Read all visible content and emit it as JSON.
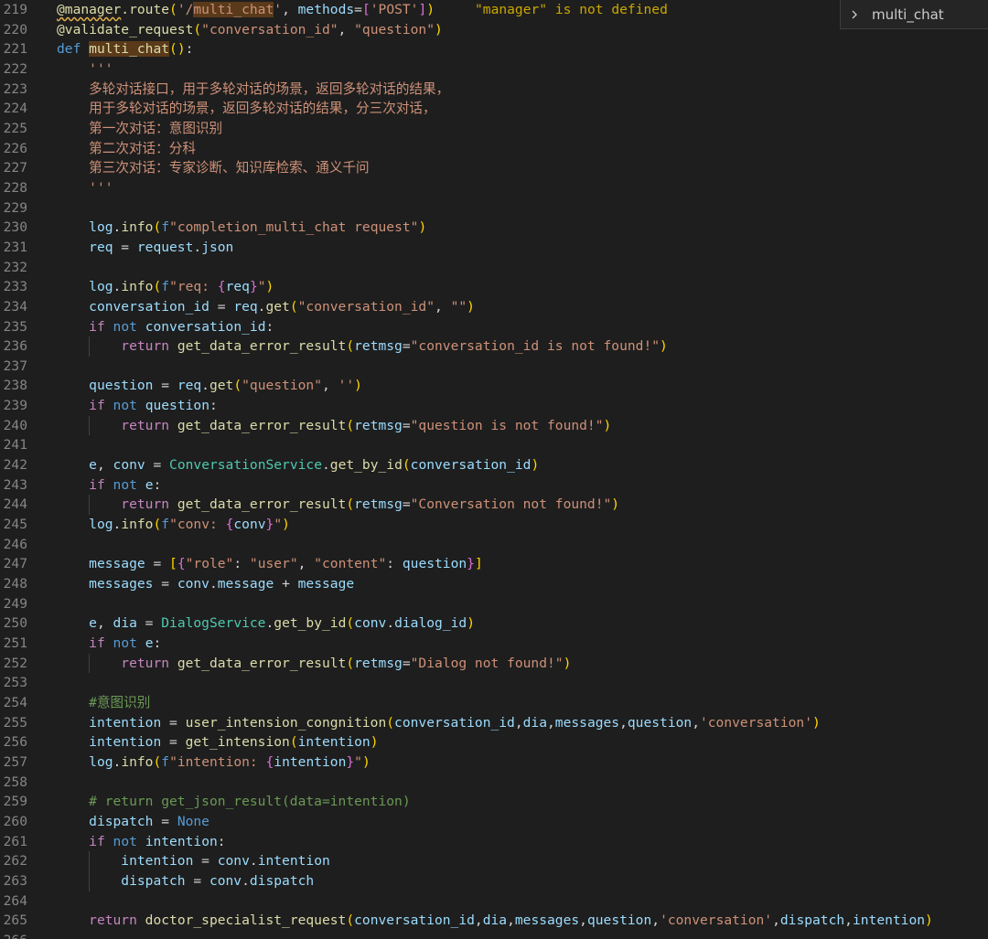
{
  "editor": {
    "language": "python",
    "theme": "dark",
    "colors": {
      "background": "#1e1e1e",
      "line_number": "#858585",
      "keyword": "#569cd6",
      "control_keyword": "#c586c0",
      "function": "#dcdcaa",
      "string": "#ce9178",
      "variable": "#9cdcfe",
      "class": "#4ec9b0",
      "comment": "#6a9955",
      "highlight": "#5a3a1a"
    },
    "diagnostic": "\"manager\" is not defined",
    "breadcrumb": {
      "icon": "chevron-right-icon",
      "label": "multi_chat"
    },
    "lines": [
      {
        "n": "219",
        "text": "@manager.route('/multi_chat', methods=['POST'])"
      },
      {
        "n": "220",
        "text": "@validate_request(\"conversation_id\", \"question\")"
      },
      {
        "n": "221",
        "text": "def multi_chat():"
      },
      {
        "n": "222",
        "text": "    '''"
      },
      {
        "n": "223",
        "text": "    多轮对话接口，用于多轮对话的场景，返回多轮对话的结果，"
      },
      {
        "n": "224",
        "text": "    用于多轮对话的场景，返回多轮对话的结果，分三次对话，"
      },
      {
        "n": "225",
        "text": "    第一次对话：意图识别"
      },
      {
        "n": "226",
        "text": "    第二次对话：分科"
      },
      {
        "n": "227",
        "text": "    第三次对话：专家诊断、知识库检索、通义千问"
      },
      {
        "n": "228",
        "text": "    '''"
      },
      {
        "n": "229",
        "text": ""
      },
      {
        "n": "230",
        "text": "    log.info(f\"completion_multi_chat request\")"
      },
      {
        "n": "231",
        "text": "    req = request.json"
      },
      {
        "n": "232",
        "text": ""
      },
      {
        "n": "233",
        "text": "    log.info(f\"req: {req}\")"
      },
      {
        "n": "234",
        "text": "    conversation_id = req.get(\"conversation_id\", \"\")"
      },
      {
        "n": "235",
        "text": "    if not conversation_id:"
      },
      {
        "n": "236",
        "text": "        return get_data_error_result(retmsg=\"conversation_id is not found!\")"
      },
      {
        "n": "237",
        "text": ""
      },
      {
        "n": "238",
        "text": "    question = req.get(\"question\", '')"
      },
      {
        "n": "239",
        "text": "    if not question:"
      },
      {
        "n": "240",
        "text": "        return get_data_error_result(retmsg=\"question is not found!\")"
      },
      {
        "n": "241",
        "text": ""
      },
      {
        "n": "242",
        "text": "    e, conv = ConversationService.get_by_id(conversation_id)"
      },
      {
        "n": "243",
        "text": "    if not e:"
      },
      {
        "n": "244",
        "text": "        return get_data_error_result(retmsg=\"Conversation not found!\")"
      },
      {
        "n": "245",
        "text": "    log.info(f\"conv: {conv}\")"
      },
      {
        "n": "246",
        "text": ""
      },
      {
        "n": "247",
        "text": "    message = [{\"role\": \"user\", \"content\": question}]"
      },
      {
        "n": "248",
        "text": "    messages = conv.message + message"
      },
      {
        "n": "249",
        "text": ""
      },
      {
        "n": "250",
        "text": "    e, dia = DialogService.get_by_id(conv.dialog_id)"
      },
      {
        "n": "251",
        "text": "    if not e:"
      },
      {
        "n": "252",
        "text": "        return get_data_error_result(retmsg=\"Dialog not found!\")"
      },
      {
        "n": "253",
        "text": ""
      },
      {
        "n": "254",
        "text": "    #意图识别"
      },
      {
        "n": "255",
        "text": "    intention = user_intension_congnition(conversation_id,dia,messages,question,'conversation')"
      },
      {
        "n": "256",
        "text": "    intention = get_intension(intention)"
      },
      {
        "n": "257",
        "text": "    log.info(f\"intention: {intention}\")"
      },
      {
        "n": "258",
        "text": ""
      },
      {
        "n": "259",
        "text": "    # return get_json_result(data=intention)"
      },
      {
        "n": "260",
        "text": "    dispatch = None"
      },
      {
        "n": "261",
        "text": "    if not intention:"
      },
      {
        "n": "262",
        "text": "        intention = conv.intention"
      },
      {
        "n": "263",
        "text": "        dispatch = conv.dispatch"
      },
      {
        "n": "264",
        "text": ""
      },
      {
        "n": "265",
        "text": "    return doctor_specialist_request(conversation_id,dia,messages,question,'conversation',dispatch,intention)"
      },
      {
        "n": "266",
        "text": ""
      }
    ]
  }
}
